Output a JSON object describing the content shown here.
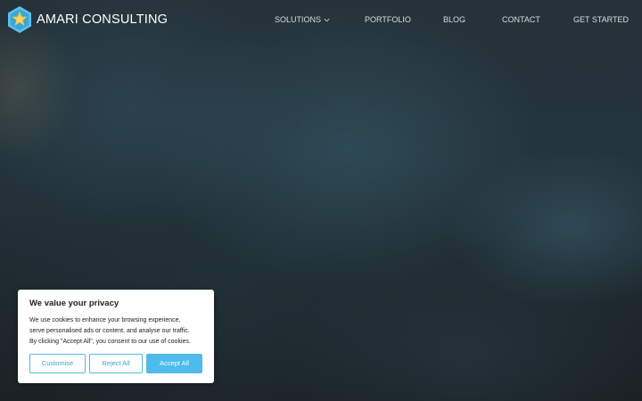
{
  "brand": {
    "name": "AMARI CONSULTING",
    "logo_icon": "hexagon-star-logo-icon",
    "colors": {
      "logo_blue": "#5bc3ee",
      "logo_gold": "#f2c94c"
    }
  },
  "nav": {
    "items": [
      {
        "label": "SOLUTIONS",
        "has_dropdown": true,
        "icon": "chevron-down-icon"
      },
      {
        "label": "PORTFOLIO"
      },
      {
        "label": "BLOG"
      },
      {
        "label": "CONTACT"
      },
      {
        "label": "GET STARTED"
      }
    ]
  },
  "cookie_banner": {
    "title": "We value your privacy",
    "body_lines": [
      "We use cookies to enhance your browsing experience,",
      "serve personalised ads or content, and analyse our traffic.",
      "By clicking \"Accept All\", you consent to our use of cookies."
    ],
    "buttons": {
      "customise": "Customise",
      "reject": "Reject All",
      "accept": "Accept All"
    },
    "colors": {
      "accent": "#4fbbec",
      "text": "#212121"
    }
  }
}
